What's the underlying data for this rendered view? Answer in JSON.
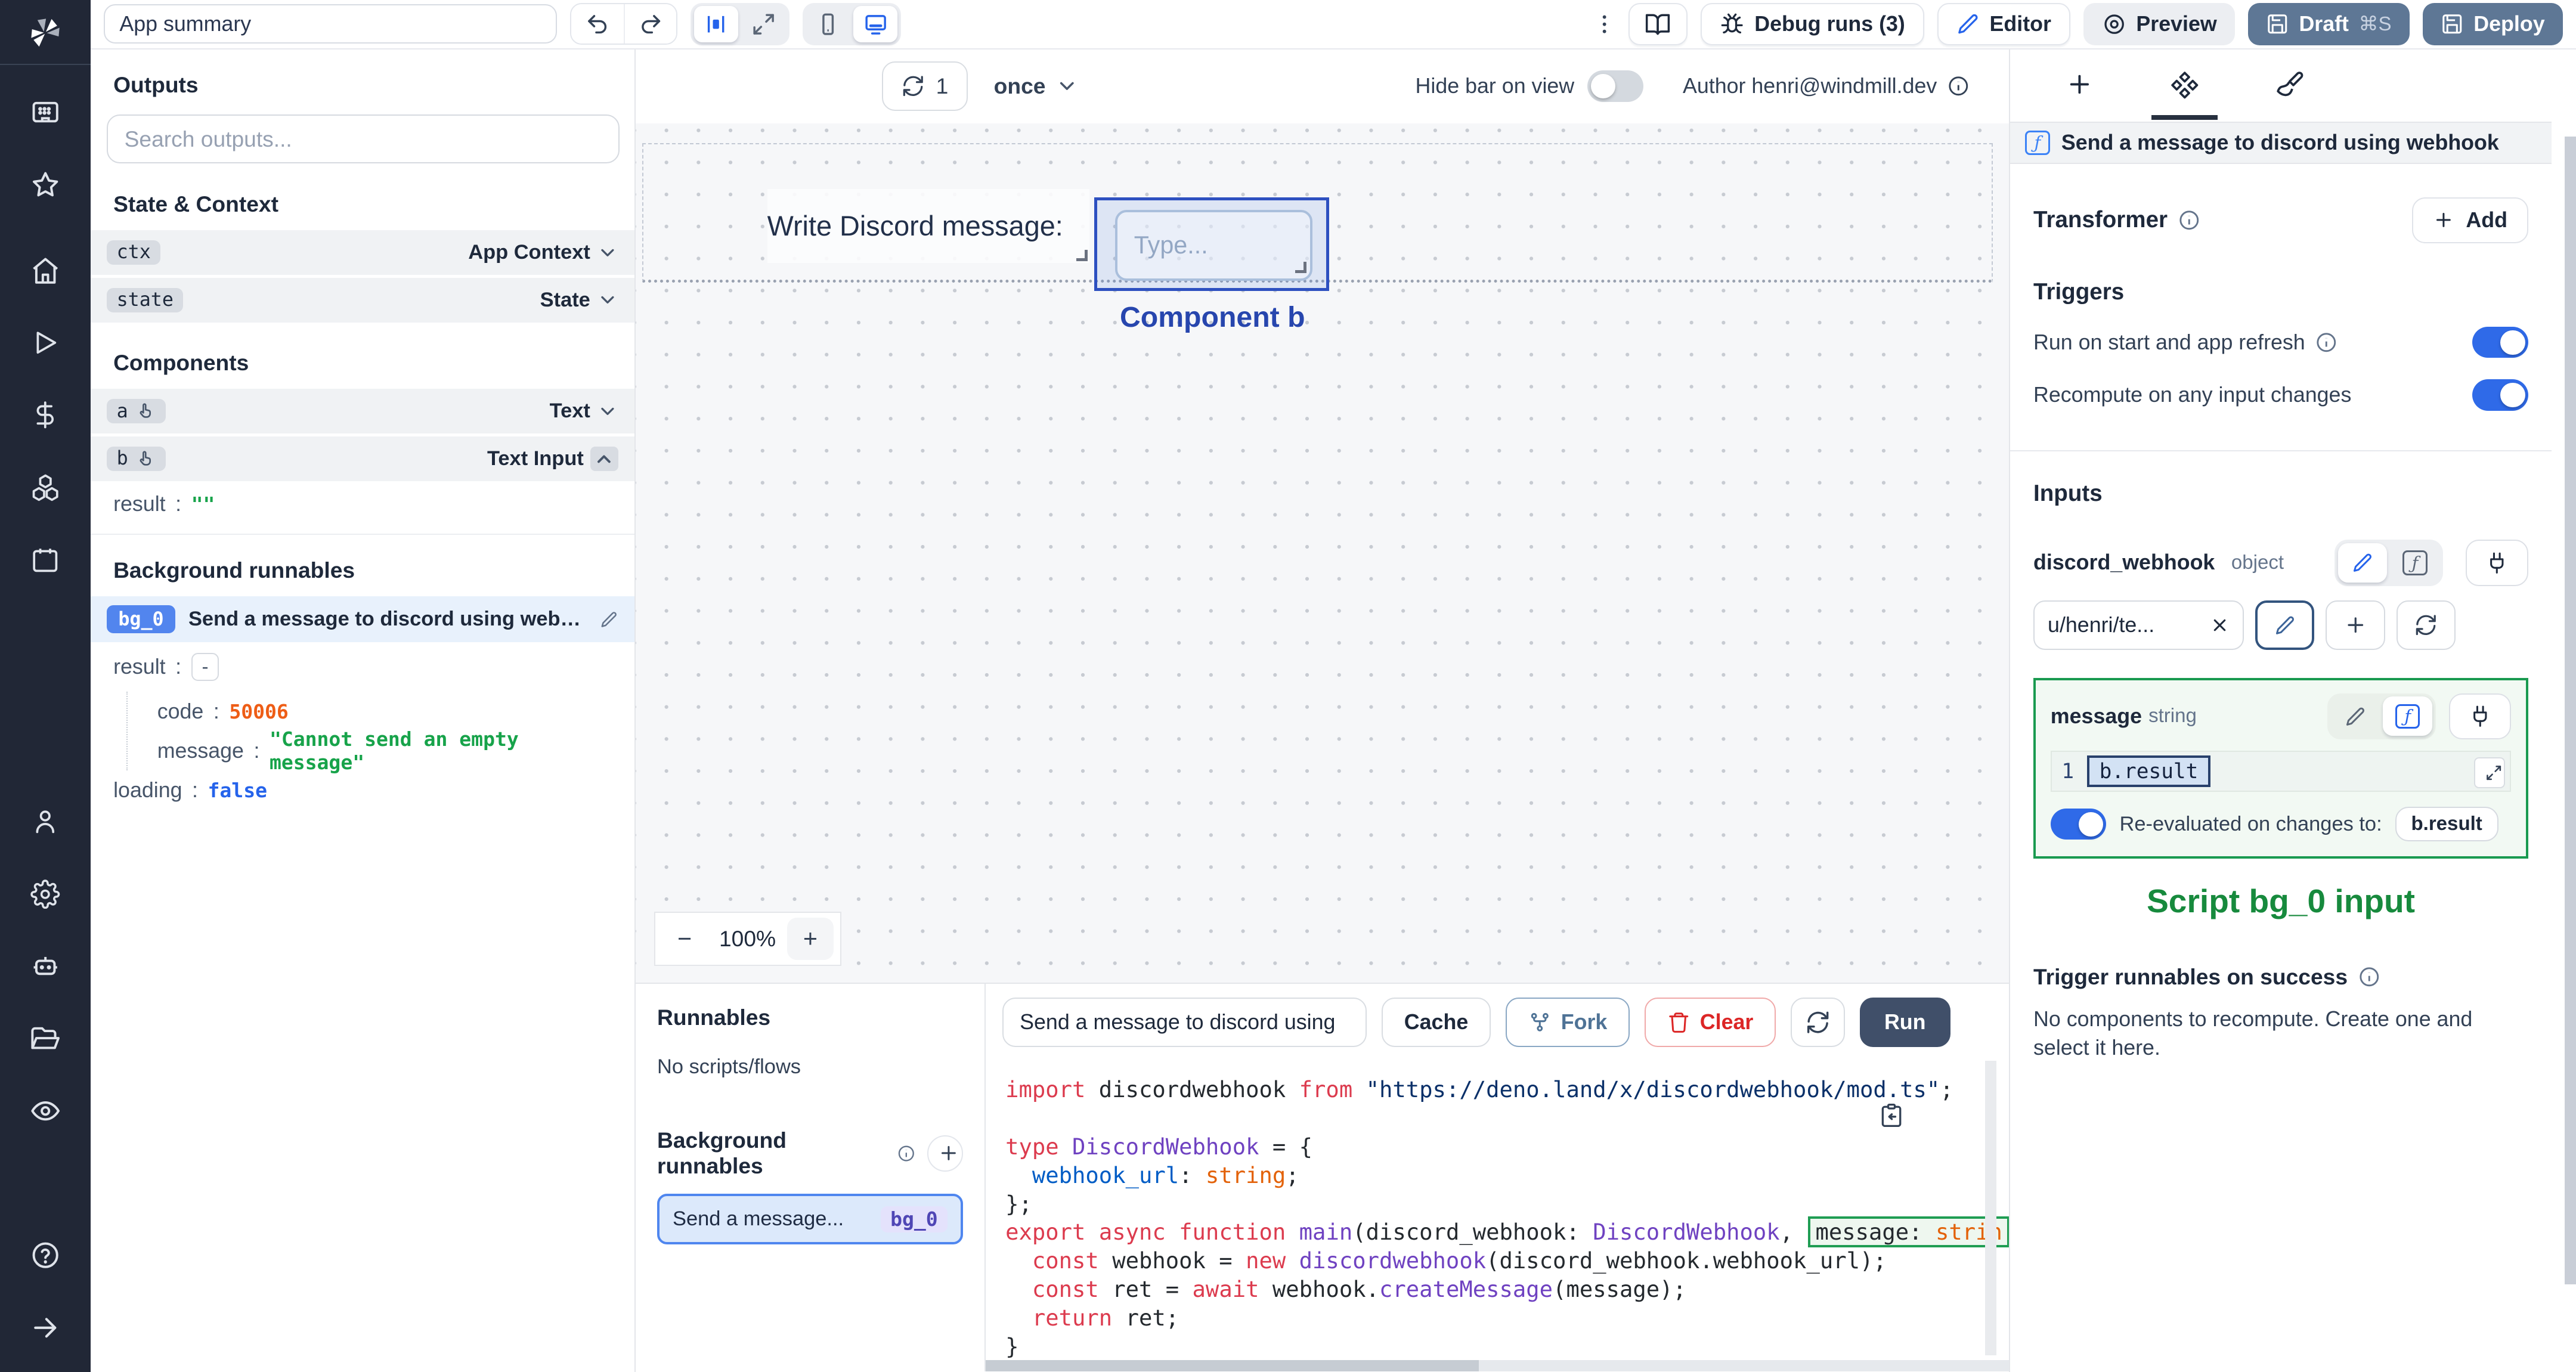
{
  "topbar": {
    "app_summary": "App summary",
    "debug_runs": "Debug runs (3)",
    "editor": "Editor",
    "preview": "Preview",
    "draft": "Draft",
    "draft_shortcut": "⌘S",
    "deploy": "Deploy"
  },
  "canvas_bar": {
    "refresh_count": "1",
    "mode": "once",
    "hide_bar": "Hide bar on view",
    "author": "Author henri@windmill.dev"
  },
  "outputs": {
    "title": "Outputs",
    "search_placeholder": "Search outputs...",
    "state_context_heading": "State & Context",
    "components_heading": "Components",
    "background_heading": "Background runnables",
    "ctx": {
      "key": "ctx",
      "kind": "App Context"
    },
    "state": {
      "key": "state",
      "kind": "State"
    },
    "comp_a": {
      "key": "a",
      "kind": "Text"
    },
    "comp_b": {
      "key": "b",
      "kind": "Text Input"
    },
    "b_result": {
      "key": "result",
      "value": "\"\""
    },
    "bg": {
      "badge": "bg_0",
      "title": "Send a message to discord using webhook",
      "result_key": "result",
      "result_value": "-",
      "code_key": "code",
      "code_value": "50006",
      "message_key": "message",
      "message_value": "\"Cannot send an empty message\"",
      "loading_key": "loading",
      "loading_value": "false"
    }
  },
  "canvas": {
    "text_component": "Write Discord message:",
    "input_placeholder": "Type...",
    "selection_label": "Component b",
    "zoom_out": "−",
    "zoom_level": "100%",
    "zoom_in": "+"
  },
  "runnables": {
    "title": "Runnables",
    "empty": "No scripts/flows",
    "bg_title": "Background runnables",
    "item": {
      "title": "Send a message...",
      "badge": "bg_0"
    }
  },
  "code_panel": {
    "name": "Send a message to discord using",
    "cache": "Cache",
    "fork": "Fork",
    "clear": "Clear",
    "run": "Run",
    "lines": [
      [
        {
          "t": "import",
          "c": "k"
        },
        {
          "t": " discordwebhook ",
          "c": "d"
        },
        {
          "t": "from",
          "c": "k"
        },
        {
          "t": " ",
          "c": "d"
        },
        {
          "t": "\"https://deno.land/x/discordwebhook/mod.ts\"",
          "c": "s"
        },
        {
          "t": ";",
          "c": "d"
        }
      ],
      [],
      [
        {
          "t": "type",
          "c": "k"
        },
        {
          "t": " ",
          "c": "d"
        },
        {
          "t": "DiscordWebhook",
          "c": "t"
        },
        {
          "t": " = {",
          "c": "d"
        }
      ],
      [
        {
          "t": "  ",
          "c": "d"
        },
        {
          "t": "webhook_url",
          "c": "p"
        },
        {
          "t": ": ",
          "c": "d"
        },
        {
          "t": "string",
          "c": "b"
        },
        {
          "t": ";",
          "c": "d"
        }
      ],
      [
        {
          "t": "};",
          "c": "d"
        }
      ],
      [
        {
          "t": "export",
          "c": "k"
        },
        {
          "t": " ",
          "c": "d"
        },
        {
          "t": "async",
          "c": "k"
        },
        {
          "t": " ",
          "c": "d"
        },
        {
          "t": "function",
          "c": "k"
        },
        {
          "t": " ",
          "c": "d"
        },
        {
          "t": "main",
          "c": "t"
        },
        {
          "t": "(discord_webhook: ",
          "c": "d"
        },
        {
          "t": "DiscordWebhook",
          "c": "t"
        },
        {
          "t": ", ",
          "c": "d"
        },
        {
          "hl": true,
          "segs": [
            {
              "t": "message: ",
              "c": "d"
            },
            {
              "t": "strin",
              "c": "b"
            }
          ]
        }
      ],
      [
        {
          "t": "  ",
          "c": "d"
        },
        {
          "t": "const",
          "c": "k"
        },
        {
          "t": " webhook = ",
          "c": "d"
        },
        {
          "t": "new",
          "c": "k"
        },
        {
          "t": " ",
          "c": "d"
        },
        {
          "t": "discordwebhook",
          "c": "t"
        },
        {
          "t": "(discord_webhook.webhook_url);",
          "c": "d"
        }
      ],
      [
        {
          "t": "  ",
          "c": "d"
        },
        {
          "t": "const",
          "c": "k"
        },
        {
          "t": " ret = ",
          "c": "d"
        },
        {
          "t": "await",
          "c": "k"
        },
        {
          "t": " webhook.",
          "c": "d"
        },
        {
          "t": "createMessage",
          "c": "t"
        },
        {
          "t": "(message);",
          "c": "d"
        }
      ],
      [
        {
          "t": "  ",
          "c": "d"
        },
        {
          "t": "return",
          "c": "k"
        },
        {
          "t": " ret;",
          "c": "d"
        }
      ],
      [
        {
          "t": "}",
          "c": "d"
        }
      ]
    ]
  },
  "right_panel": {
    "header": "Send a message to discord using webhook",
    "transformer": "Transformer",
    "add": "Add",
    "triggers": "Triggers",
    "run_on_start": "Run on start and app refresh",
    "recompute": "Recompute on any input changes",
    "inputs": "Inputs",
    "discord": {
      "key": "discord_webhook",
      "type": "object",
      "value": "u/henri/te..."
    },
    "message": {
      "key": "message",
      "type": "string",
      "line_no": "1",
      "expr": "b.result",
      "reeval": "Re-evaluated on changes to:",
      "reeval_target": "b.result"
    },
    "script_label": "Script bg_0 input",
    "trigger_success": "Trigger runnables on success",
    "no_components": "No components to recompute. Create one and select it here."
  }
}
